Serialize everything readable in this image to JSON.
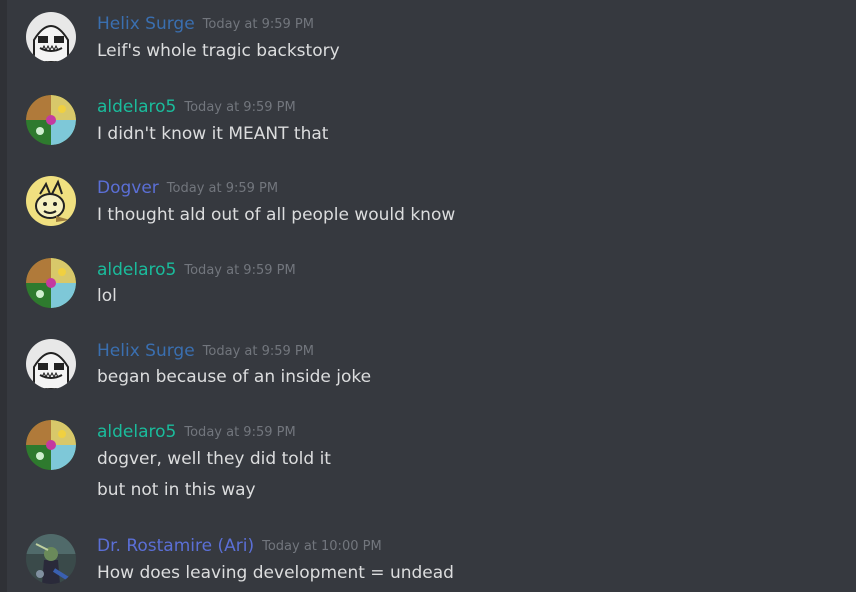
{
  "colors": {
    "background": "#36393f",
    "text": "#dcddde",
    "timestamp": "#72767d",
    "helix_surge": "#3a6fb0",
    "aldelaro5": "#1abc9c",
    "dogver": "#5b6fd6",
    "dr_rostamire": "#5b6fd6"
  },
  "messages": [
    {
      "author": "Helix Surge",
      "author_color": "#3a6fb0",
      "avatar": "helix-surge-avatar",
      "timestamp": "Today at 9:59 PM",
      "lines": [
        "Leif's whole tragic backstory"
      ]
    },
    {
      "author": "aldelaro5",
      "author_color": "#1abc9c",
      "avatar": "aldelaro5-avatar",
      "timestamp": "Today at 9:59 PM",
      "lines": [
        "I didn't know it MEANT that"
      ]
    },
    {
      "author": "Dogver",
      "author_color": "#5b6fd6",
      "avatar": "dogver-avatar",
      "timestamp": "Today at 9:59 PM",
      "lines": [
        "I thought ald out of all people would know"
      ]
    },
    {
      "author": "aldelaro5",
      "author_color": "#1abc9c",
      "avatar": "aldelaro5-avatar",
      "timestamp": "Today at 9:59 PM",
      "lines": [
        "lol"
      ]
    },
    {
      "author": "Helix Surge",
      "author_color": "#3a6fb0",
      "avatar": "helix-surge-avatar",
      "timestamp": "Today at 9:59 PM",
      "lines": [
        "began because of an inside joke"
      ]
    },
    {
      "author": "aldelaro5",
      "author_color": "#1abc9c",
      "avatar": "aldelaro5-avatar",
      "timestamp": "Today at 9:59 PM",
      "lines": [
        "dogver, well they did told it",
        "but not in this way"
      ]
    },
    {
      "author": "Dr. Rostamire (Ari)",
      "author_color": "#5b6fd6",
      "avatar": "dr-rostamire-avatar",
      "timestamp": "Today at 10:00 PM",
      "lines": [
        "How does leaving development = undead"
      ]
    }
  ]
}
